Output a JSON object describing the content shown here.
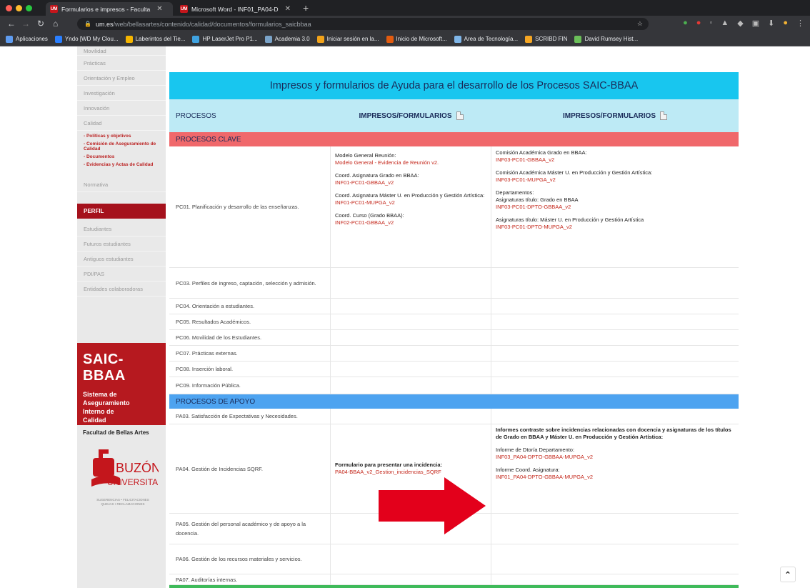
{
  "browser": {
    "tabs": [
      {
        "icon": "UM",
        "label": "Formularios e impresos - Faculta"
      },
      {
        "icon": "UM",
        "label": "Microsoft Word - INF01_PA04-D"
      }
    ],
    "url_host": "um.es",
    "url_path": "/web/bellasartes/contenido/calidad/documentos/formularios_saicbbaa",
    "bookmarks": [
      {
        "label": "Aplicaciones",
        "color": "#5f9cf0"
      },
      {
        "label": "Yndo [WD My Clou...",
        "color": "#2a7fff"
      },
      {
        "label": "Laberintos del Tie...",
        "color": "#f5b500"
      },
      {
        "label": "HP LaserJet Pro P1...",
        "color": "#3fa2e0"
      },
      {
        "label": "Academia 3.0",
        "color": "#7aa3c8"
      },
      {
        "label": "Iniciar sesión en la...",
        "color": "#f2a31a"
      },
      {
        "label": "Inicio de Microsoft...",
        "color": "#e25b0f"
      },
      {
        "label": "Area de Tecnología...",
        "color": "#7fb6e8"
      },
      {
        "label": "SCRIBD FIN",
        "color": "#f5a623"
      },
      {
        "label": "David Rumsey Hist...",
        "color": "#6bbf59"
      }
    ]
  },
  "sidebar": {
    "top_items": [
      "Movilidad",
      "Prácticas",
      "Orientación y Empleo",
      "Investigación",
      "Innovación",
      "Calidad"
    ],
    "calidad_sub": [
      "- Políticas y objetivos",
      "- Comisión de Aseguramiento de Calidad",
      "- Documentos",
      "- Evidencias y Actas de Calidad"
    ],
    "normativa": "Normativa",
    "perfil": "PERFIL",
    "perfil_items": [
      "Estudiantes",
      "Futuros estudiantes",
      "Antiguos estudiantes",
      "PDI/PAS",
      "Entidades colaboradoras"
    ],
    "saic_title": "SAIC-BBAA",
    "saic_sub": [
      "Sistema de",
      "Aseguramiento",
      "Interno de",
      "Calidad"
    ],
    "faculty": "Facultad de Bellas Artes",
    "buzon_title": "BUZÓN",
    "buzon_sub": "UNIVERSITARIO",
    "buzon_caption": "SUGERENCIAS • FELICITACIONES\nQUEJAS • RECLAMACIONES"
  },
  "table": {
    "title": "Impresos y formularios de Ayuda para el desarrollo de los Procesos SAIC-BBAA",
    "headers": [
      "PROCESOS",
      "IMPRESOS/FORMULARIOS",
      "IMPRESOS/FORMULARIOS"
    ],
    "clave_label": "PROCESOS CLAVE",
    "apoyo_label": "PROCESOS DE APOYO",
    "pc01": {
      "name": "PC01. Planificación y desarrollo de las enseñanzas.",
      "col2": [
        {
          "label": "Modelo General Reunión:",
          "link": "Modelo General - Evidencia de Reunión v2."
        },
        {
          "label": "Coord. Asignatura Grado en BBAA:",
          "link": "INF01-PC01-GBBAA_v2"
        },
        {
          "label": "Coord. Asignatura Máster U. en Producción y Gestión Artística:",
          "link": "INF01-PC01-MUPGA_v2"
        },
        {
          "label": "Coord. Curso (Grado BBAA):",
          "link": "INF02-PC01-GBBAA_v2"
        }
      ],
      "col3": [
        {
          "label": "Comisión Académica Grado en BBAA:",
          "link": "INF03-PC01-GBBAA_v2"
        },
        {
          "label": "Comisión Académica Máster U. en Producción y Gestión Artística:",
          "link": "INF03-PC01-MUPGA_v2"
        },
        {
          "label": "Departamentos:\nAsignaturas título: Grado en BBAA",
          "link": "INF03-PC01-DPTO-GBBAA_v2"
        },
        {
          "label": "Asignaturas título: Máster U. en Producción y Gestión Artística",
          "link": "INF03-PC01-DPTO-MUPGA_v2"
        }
      ]
    },
    "pc_rows": [
      "PC03. Perfiles de ingreso, captación, selección y admisión.",
      "PC04. Orientación a estudiantes.",
      "PC05. Resultados Académicos.",
      "PC06. Movilidad de los Estudiantes.",
      "PC07. Prácticas externas.",
      "PC08. Inserción laboral.",
      "PC09. Información Pública."
    ],
    "pa03": "PA03. Satisfacción de Expectativas y Necesidades.",
    "pa04": {
      "name": "PA04. Gestión de Incidencias SQRF.",
      "col2_label": "Formulario para presentar una incidencia:",
      "col2_link": "PA04-BBAA_v2_Gestion_incidencias_SQRF",
      "col3_heading": "Informes contraste sobre incidencias relacionadas con docencia y asignaturas de los títulos de Grado en BBAA y Máster U. en Producción y Gestión Artística:",
      "col3_items": [
        {
          "label": "Informe de Dtor/a Departamento:",
          "link": "INF03_PA04-DPTO-GBBAA-MUPGA_v2"
        },
        {
          "label": "Informe Coord. Asignatura:",
          "link": "INF01_PA04-DPTO-GBBAA-MUPGA_v2"
        }
      ]
    },
    "pa_rows": [
      "PA05. Gestión del personal académico y de apoyo a la docencia.",
      "PA06. Gestión de los recursos materiales y servicios.",
      "PA07. Auditorías internas."
    ]
  },
  "colors": {
    "accent_red": "#c4281c",
    "title_cyan": "#18c6ef",
    "clave": "#f0686b",
    "apoyo": "#4da3f0",
    "arrow": "#e3001b"
  }
}
